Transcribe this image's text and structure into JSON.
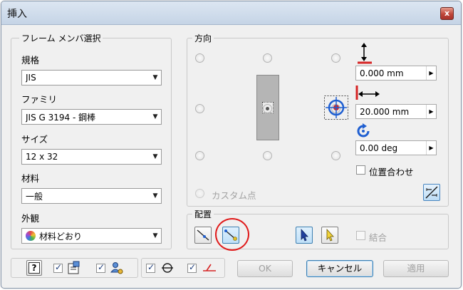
{
  "window": {
    "title": "挿入",
    "close_glyph": "x"
  },
  "frame_member": {
    "group_label": "フレーム メンバ選択",
    "standard": {
      "label": "規格",
      "value": "JIS"
    },
    "family": {
      "label": "ファミリ",
      "value": "JIS G 3194 - 鋼棒"
    },
    "size": {
      "label": "サイズ",
      "value": "12 x 32"
    },
    "material": {
      "label": "材料",
      "value": "一般"
    },
    "appearance": {
      "label": "外観",
      "value": "材料どおり"
    }
  },
  "orientation": {
    "group_label": "方向",
    "selected_anchor": "center",
    "custom_point_label": "カスタム点",
    "vertical_offset": "0.000 mm",
    "horizontal_offset": "20.000 mm",
    "rotation": "0.00 deg",
    "align_label": "位置合わせ"
  },
  "placement": {
    "group_label": "配置",
    "combine_label": "結合"
  },
  "footer": {
    "ok_label": "OK",
    "cancel_label": "キャンセル",
    "apply_label": "適用"
  },
  "colors": {
    "highlight_circle": "#e01b1b",
    "accent_blue": "#1f5fd1"
  }
}
